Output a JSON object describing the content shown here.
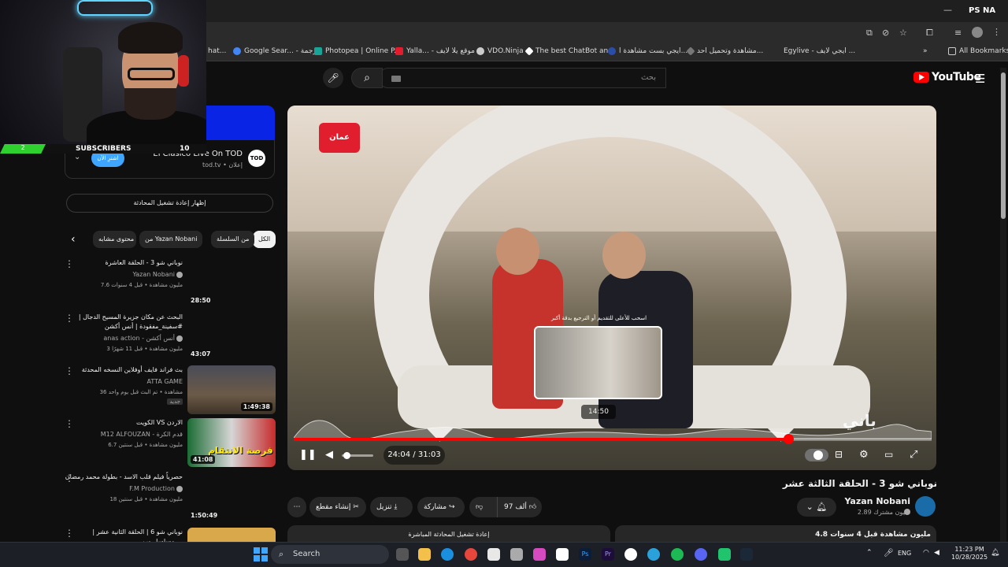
{
  "browser": {
    "top_right": "PS NA",
    "bookmarks": [
      {
        "label": "hat..."
      },
      {
        "label": "Google Sear... - ترجمة"
      },
      {
        "label": "Photopea | Online P..."
      },
      {
        "label": "Yalla... - موقع يلا لايف"
      },
      {
        "label": "VDO.Ninja"
      },
      {
        "label": "The best ChatBot an..."
      },
      {
        "label": "ايجي بست مشاهدة ا..."
      },
      {
        "label": "مشاهدة وتحميل احد..."
      },
      {
        "label": "Egylive - ايجي لايف ..."
      }
    ],
    "all_bookmarks": "All Bookmarks"
  },
  "webcam": {
    "subs_count_left": "2",
    "subs_label": "SUBSCRIBERS",
    "subs_count_right": "10"
  },
  "youtube": {
    "logo_text": "YouTube",
    "search_placeholder": "بحث"
  },
  "live_chat": {
    "title": "El Clasico Live On TOD",
    "sub": "tod.tv • إعلان",
    "logo": "TOD",
    "join_button": "اشترِ الآن",
    "replay_button": "إظهار إعادة تشغيل المحادثة"
  },
  "chips": [
    {
      "label": "الكل",
      "active": true
    },
    {
      "label": "من السلسلة",
      "active": false
    },
    {
      "label": "من Yazan Nobani",
      "active": false
    },
    {
      "label": "محتوى مشابه",
      "active": false
    }
  ],
  "related": [
    {
      "title": "نوباني شو 3 - الحلقة العاشرة",
      "channel": "Yazan Nobani",
      "meta": "7.6 مليون مشاهدة • قبل 4 سنوات",
      "duration": "28:50"
    },
    {
      "title": "البحث عن مكان جزيرة المسيح الدجال | #سفينة_مفقودة | أنس أكشن",
      "channel": "anas action - أنس أكشن",
      "meta": "3 مليون مشاهدة • قبل 11 شهرًا",
      "duration": "43:07"
    },
    {
      "title": "بث فراند فايف أوفلاين النسخه المحدثة",
      "channel": "ATTA GAME",
      "meta": "36 مشاهدة • تم البث قبل يوم واحد",
      "badge": "جديد",
      "duration": "1:49:38"
    },
    {
      "title": "الكويت VS الاردن",
      "channel": "M12 ALFOUZAN - قدم الكرة",
      "meta": "6.7 مليون مشاهدة • قبل سنتين",
      "duration": "41:08",
      "thumb_text": "فرصة الانتقام"
    },
    {
      "title": "حصرياً فيلم قلب الاسد - بطولة محمد رمضان",
      "channel": "F.M Production",
      "meta": "18 مليون مشاهدة • قبل سنتين",
      "duration": "1:50:49"
    },
    {
      "title": "نوباني شو 6 | الحلقة الثانية عشر | مسلسل وين ...",
      "channel": "",
      "meta": "",
      "duration": ""
    }
  ],
  "player": {
    "channel_logo": "عمان",
    "watermark": "باني",
    "preview_hint": "اسحب للأعلى للتقديم أو الترجيع بدقة أكبر",
    "preview_time": "14:50",
    "current_time": "24:04",
    "duration": "31:03",
    "time_display": "24:04 / 31:03",
    "progress": 0.775,
    "volume": 0.15
  },
  "video": {
    "title": "نوباني شو 3 - الحلقة الثالثة عشر",
    "channel": "Yazan Nobani",
    "subscribers": "2.89 مليون مشترك",
    "likes": "97 ألف",
    "share": "مشاركة",
    "download": "تنزيل",
    "clip": "إنشاء مقطع",
    "description": "4.8 مليون مشاهدة قبل 4 سنوات",
    "chat_replay": "إعادة تشغيل المحادثة المباشرة"
  },
  "taskbar": {
    "search": "Search",
    "lang": "ENG",
    "time": "11:23 PM",
    "date": "10/28/2025"
  }
}
